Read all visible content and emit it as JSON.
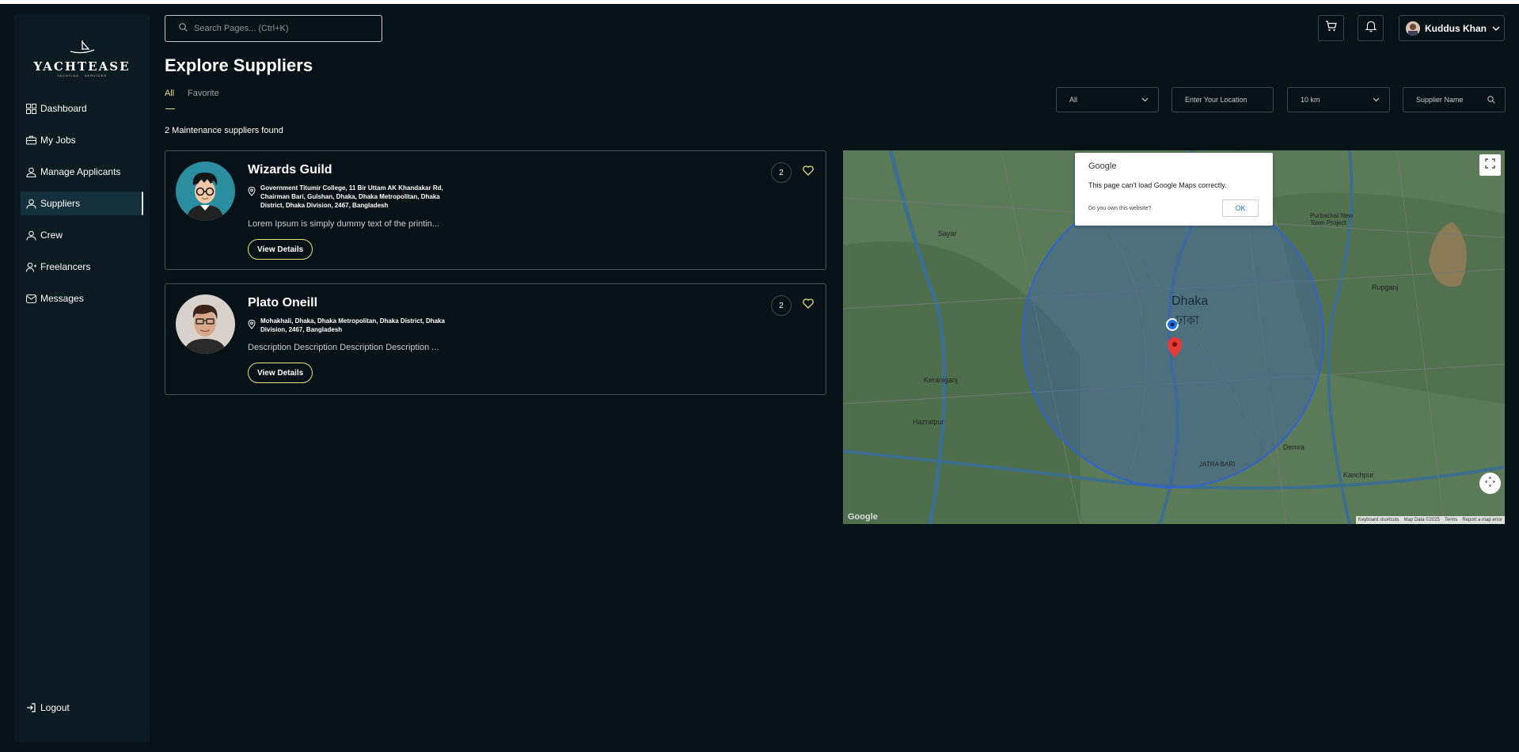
{
  "brand": {
    "name": "YACHTEASE",
    "tagline": "YACHTING · SERVICES"
  },
  "sidebar": {
    "items": [
      {
        "label": "Dashboard",
        "icon": "dashboard-icon"
      },
      {
        "label": "My Jobs",
        "icon": "briefcase-icon"
      },
      {
        "label": "Manage Applicants",
        "icon": "applicants-icon"
      },
      {
        "label": "Suppliers",
        "icon": "suppliers-icon",
        "active": true
      },
      {
        "label": "Crew",
        "icon": "crew-icon"
      },
      {
        "label": "Freelancers",
        "icon": "freelancers-icon"
      },
      {
        "label": "Messages",
        "icon": "mail-icon"
      }
    ],
    "logout": "Logout"
  },
  "header": {
    "search_placeholder": "Search Pages... (Ctrl+K)",
    "user_name": "Kuddus Khan"
  },
  "page": {
    "title": "Explore Suppliers",
    "tabs": [
      {
        "label": "All",
        "active": true
      },
      {
        "label": "Favorite",
        "active": false
      }
    ],
    "results_text": "2 Maintenance suppliers found"
  },
  "filters": {
    "category_value": "All",
    "location_placeholder": "Enter Your Location",
    "radius_value": "10 km",
    "name_placeholder": "Supplier Name"
  },
  "suppliers": [
    {
      "name": "Wizards Guild",
      "address": "Government Titumir College, 11 Bir Uttam AK Khandakar Rd, Chairman Bari, Gulshan, Dhaka, Dhaka Metropolitan, Dhaka District, Dhaka Division, 2467, Bangladesh",
      "description": "Lorem Ipsum is simply dummy text of the printin...",
      "count": "2",
      "button": "View Details"
    },
    {
      "name": "Plato Oneill",
      "address": "Mohakhali, Dhaka, Dhaka Metropolitan, Dhaka District, Dhaka Division, 2467, Bangladesh",
      "description": "Description Description Description Description ...",
      "count": "2",
      "button": "View Details"
    }
  ],
  "map": {
    "dialog_brand": "Google",
    "dialog_message": "This page can't load Google Maps correctly.",
    "dialog_question": "Do you own this website?",
    "dialog_ok": "OK",
    "city_label": "Dhaka",
    "city_label_local": "ঢাকা",
    "place_labels": [
      "Sayar",
      "Demra",
      "Kanchpur",
      "Hazratpur",
      "Keraniganj",
      "Purbachal New Town Project",
      "Rupganj",
      "JATRA BARI"
    ],
    "footer": [
      "Keyboard shortcuts",
      "Map Data ©2025",
      "Terms",
      "Report a map error"
    ],
    "logo": "Google"
  }
}
